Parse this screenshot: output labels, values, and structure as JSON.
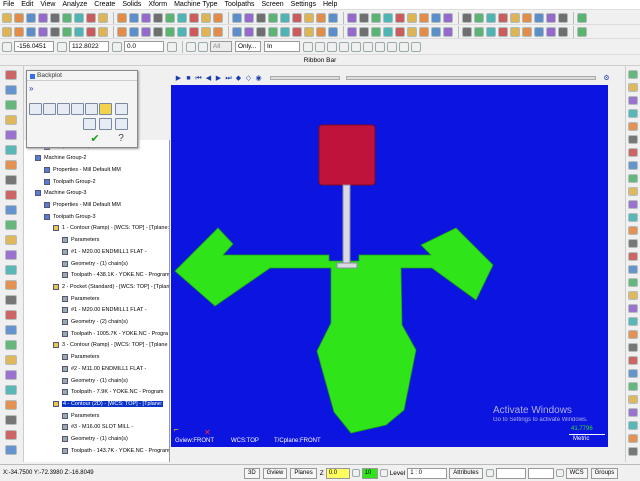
{
  "menu": [
    "File",
    "Edit",
    "View",
    "Analyze",
    "Create",
    "Solids",
    "Xform",
    "Machine Type",
    "Toolpaths",
    "Screen",
    "Settings",
    "Help"
  ],
  "toolbar3": {
    "x_value": "-156.0451",
    "y_value": "112.8022",
    "z_value": "0.0",
    "all_label": "All",
    "only_label": "Only...",
    "in_label": "In"
  },
  "ribbon_label": "Ribbon Bar",
  "backplot": {
    "title": "Backplot"
  },
  "tree": [
    {
      "text": "Toolpath Group-1",
      "indent": 2
    },
    {
      "text": "Machine Group-2",
      "indent": 1
    },
    {
      "text": "Properties - Mill Default MM",
      "indent": 2
    },
    {
      "text": "Toolpath Group-2",
      "indent": 2
    },
    {
      "text": "Machine Group-3",
      "indent": 1
    },
    {
      "text": "Properties - Mill Default MM",
      "indent": 2
    },
    {
      "text": "Toolpath Group-3",
      "indent": 2
    },
    {
      "text": "1 - Contour (Ramp) - [WCS: TOP] - [Tplane: TOP]",
      "indent": 3
    },
    {
      "text": "Parameters",
      "indent": 4
    },
    {
      "text": "#1 - M20.00 ENDMILL1 FLAT -",
      "indent": 4
    },
    {
      "text": "Geometry - (1) chain(s)",
      "indent": 4
    },
    {
      "text": "Toolpath - 438.1K - YOKE.NC - Program",
      "indent": 4
    },
    {
      "text": "2 - Pocket (Standard) - [WCS: TOP] - [Tplane",
      "indent": 3
    },
    {
      "text": "Parameters",
      "indent": 4
    },
    {
      "text": "#1 - M20.00 ENDMILL1 FLAT -",
      "indent": 4
    },
    {
      "text": "Geometry - (2) chain(s)",
      "indent": 4
    },
    {
      "text": "Toolpath - 1005.7K - YOKE.NC - Progra",
      "indent": 4
    },
    {
      "text": "3 - Contour (Ramp) - [WCS: TOP] - [Tplane",
      "indent": 3
    },
    {
      "text": "Parameters",
      "indent": 4
    },
    {
      "text": "#2 - M11.00 ENDMILL1 FLAT -",
      "indent": 4
    },
    {
      "text": "Geometry - (1) chain(s)",
      "indent": 4
    },
    {
      "text": "Toolpath - 7.9K - YOKE.NC - Program",
      "indent": 4
    },
    {
      "text": "4 - Contour (2D) - [WCS: TOP] - [Tplane:",
      "indent": 3,
      "selected": true
    },
    {
      "text": "Parameters",
      "indent": 4
    },
    {
      "text": "#3 - M16.00 SLOT MILL -",
      "indent": 4
    },
    {
      "text": "Geometry - (1) chain(s)",
      "indent": 4
    },
    {
      "text": "Toolpath - 143.7K - YOKE.NC - Program",
      "indent": 4
    }
  ],
  "viewport": {
    "gview": "Gview:FRONT",
    "wcs": "WCS:TOP",
    "tcplane": "T/Cplane:FRONT",
    "watermark_title": "Activate Windows",
    "watermark_sub": "Go to Settings to activate Windows.",
    "metric_value": "41.7796",
    "metric_label": "Metric"
  },
  "status": {
    "coords": "X:-34.7500   Y:-72.3980   Z:-16.8049",
    "btn_3d": "3D",
    "btn_gview": "Gview",
    "btn_planes": "Planes",
    "z_label": "Z",
    "z_value": "0.0",
    "level_value": "10",
    "level_label": "Level",
    "level_field": "1 : 0",
    "attributes": "Attributes",
    "wcs": "WCS",
    "groups": "Groups"
  },
  "colors": {
    "viewport_bg": "#0c14e0",
    "part": "#2fe51a",
    "tool_body": "#c0133c"
  }
}
